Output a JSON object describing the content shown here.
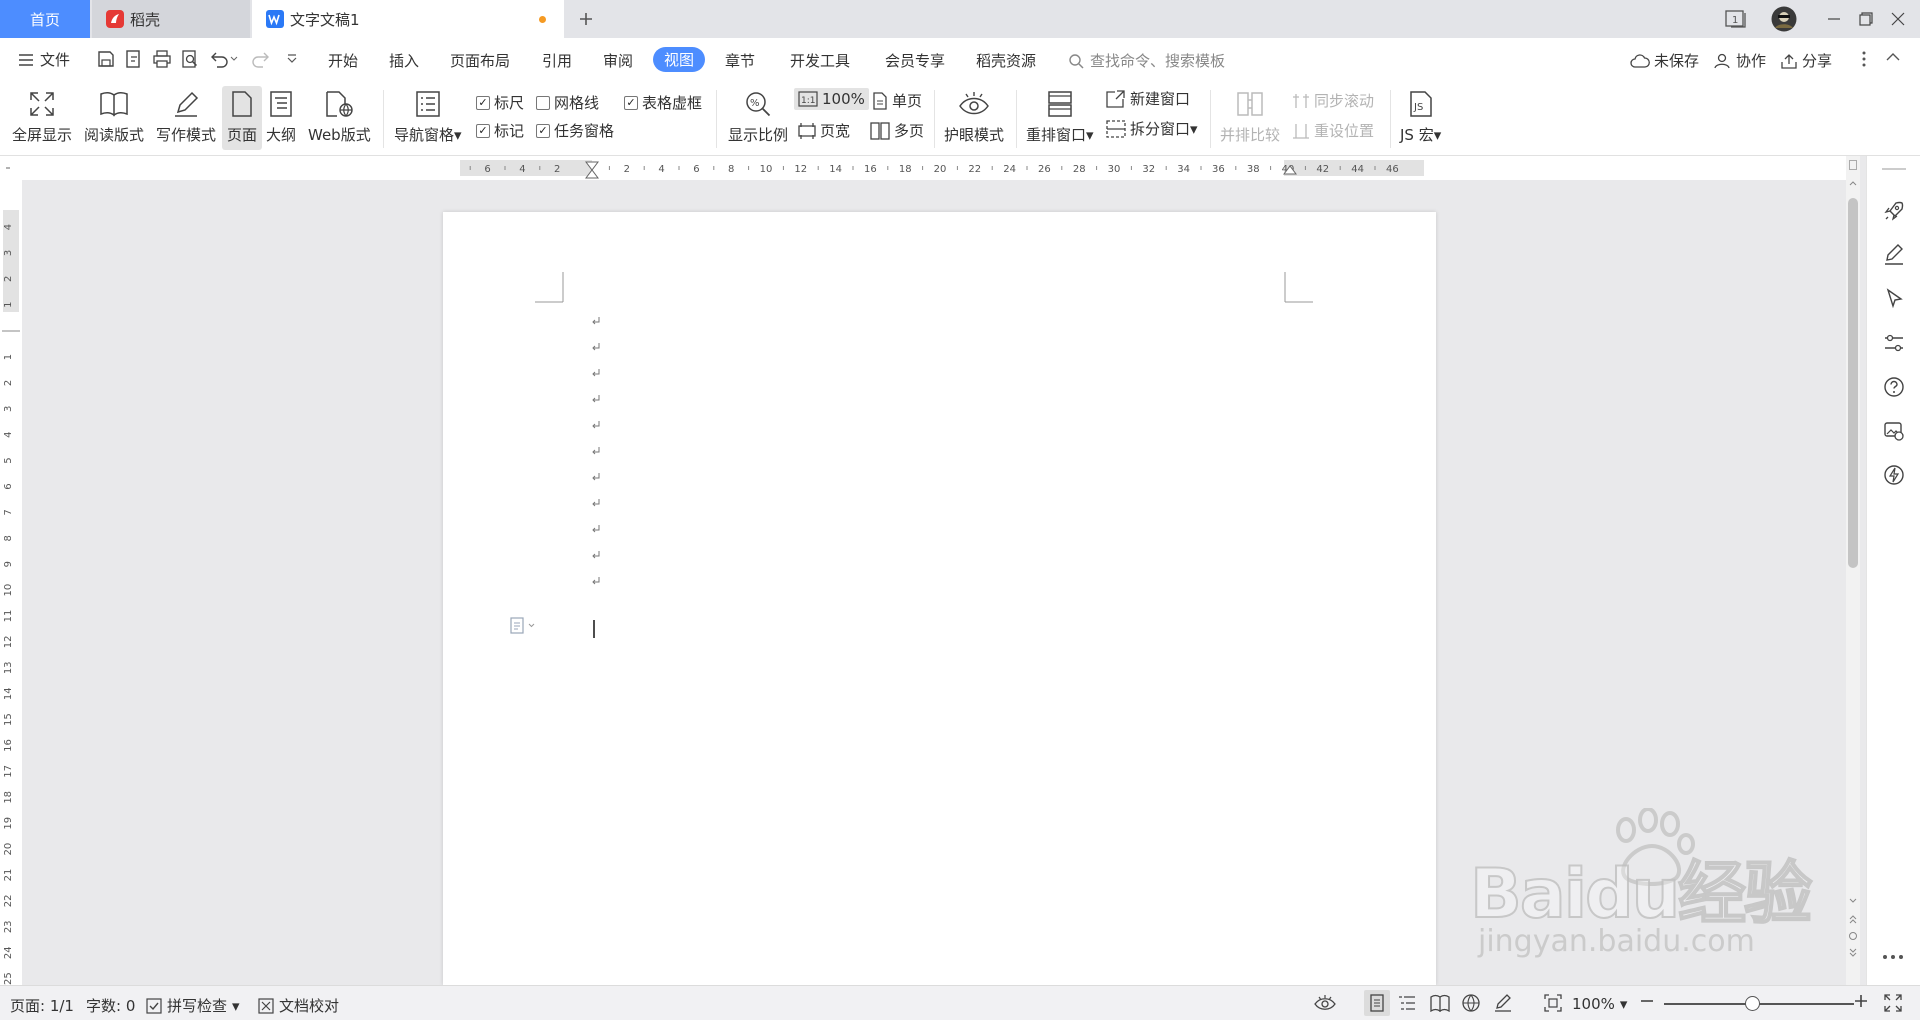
{
  "tabs": {
    "home": "首页",
    "daoke": "稻壳",
    "doc": "文字文稿1"
  },
  "menu": {
    "file": "文件",
    "items": [
      "开始",
      "插入",
      "页面布局",
      "引用",
      "审阅",
      "视图",
      "章节",
      "开发工具",
      "会员专享",
      "稻壳资源"
    ],
    "active": "视图",
    "search_placeholder": "查找命令、搜索模板",
    "unsaved": "未保存",
    "collab": "协作",
    "share": "分享"
  },
  "ribbon": {
    "fullscreen": "全屏显示",
    "reading": "阅读版式",
    "writing": "写作模式",
    "page": "页面",
    "outline": "大纲",
    "web": "Web版式",
    "nav_pane": "导航窗格",
    "ruler": "标尺",
    "gridlines": "网格线",
    "table_gridlines": "表格虚框",
    "marks": "标记",
    "task_pane": "任务窗格",
    "zoom": "显示比例",
    "zoom_100": "100%",
    "page_width": "页宽",
    "single_page": "单页",
    "multi_page": "多页",
    "eye_mode": "护眼模式",
    "arrange": "重排窗口",
    "new_window": "新建窗口",
    "split_window": "拆分窗口",
    "side_by_side": "并排比较",
    "sync_scroll": "同步滚动",
    "reset_pos": "重设位置",
    "js_macro": "JS 宏"
  },
  "ruler": {
    "h_labels": [
      "6",
      "4",
      "2",
      "2",
      "4",
      "6",
      "8",
      "10",
      "12",
      "14",
      "16",
      "18",
      "20",
      "22",
      "24",
      "26",
      "28",
      "30",
      "32",
      "34",
      "36",
      "38",
      "40",
      "42",
      "44",
      "46"
    ],
    "v_labels": [
      "4",
      "3",
      "2",
      "1",
      "1",
      "2",
      "3",
      "4",
      "5",
      "6",
      "7",
      "8",
      "9",
      "10",
      "11",
      "12",
      "13",
      "14",
      "15",
      "16",
      "17",
      "18",
      "19",
      "20",
      "21",
      "22",
      "23",
      "24",
      "25"
    ]
  },
  "status": {
    "page": "页面: 1/1",
    "words": "字数: 0",
    "spell": "拼写检查",
    "proof": "文档校对",
    "zoom": "100%"
  },
  "watermark": {
    "brand": "Baidu",
    "brand_cn": "经验",
    "url": "jingyan.baidu.com"
  },
  "colors": {
    "accent": "#4d8dff",
    "unsaved_dot": "#f59a23"
  }
}
